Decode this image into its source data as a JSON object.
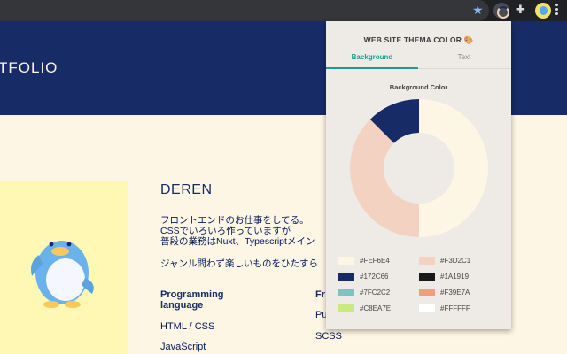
{
  "browser": {
    "bookmark_icon": "star-icon",
    "extension_icon": "color-wheel-icon",
    "extensions_menu_icon": "puzzle-icon",
    "profile_icon": "profile-avatar-icon",
    "star_glyph": "★",
    "puzzle_glyph": "✚"
  },
  "site": {
    "logo": "TFOLIO",
    "name": "DEREN",
    "bio": [
      "フロントエンドのお仕事をしてる。",
      "CSSでいろいろ作っていますが",
      "普段の業務はNuxt、Typescriptメイン",
      "ジャンル問わず楽しいものをひたすら"
    ],
    "skills": {
      "col1_heading": "Programming language",
      "col1_items": [
        "HTML / CSS",
        "JavaScript"
      ],
      "col2_heading": "Fr",
      "col2_items": [
        "Pu",
        "SCSS"
      ]
    }
  },
  "popup": {
    "title": "WEB SITE THEMA COLOR 🎨",
    "tabs": [
      "Background",
      "Text"
    ],
    "active_tab": "Background",
    "chart_title": "Background Color",
    "palette": [
      {
        "label": "#FEF6E4",
        "color": "#FEF6E4"
      },
      {
        "label": "#F3D2C1",
        "color": "#F3D2C1"
      },
      {
        "label": "#172C66",
        "color": "#172C66"
      },
      {
        "label": "#1A1919",
        "color": "#1A1919"
      },
      {
        "label": "#7FC2C2",
        "color": "#7FC2C2"
      },
      {
        "label": "#F39E7A",
        "color": "#F39E7A"
      },
      {
        "label": "#C8EA7E",
        "color": "#C8EA7E"
      },
      {
        "label": "#FFFFFF",
        "color": "#FFFFFF"
      }
    ],
    "donut": [
      {
        "color": "#FEF6E4",
        "share": 0.5
      },
      {
        "color": "#F3D2C1",
        "share": 0.375
      },
      {
        "color": "#172C66",
        "share": 0.125
      }
    ]
  }
}
